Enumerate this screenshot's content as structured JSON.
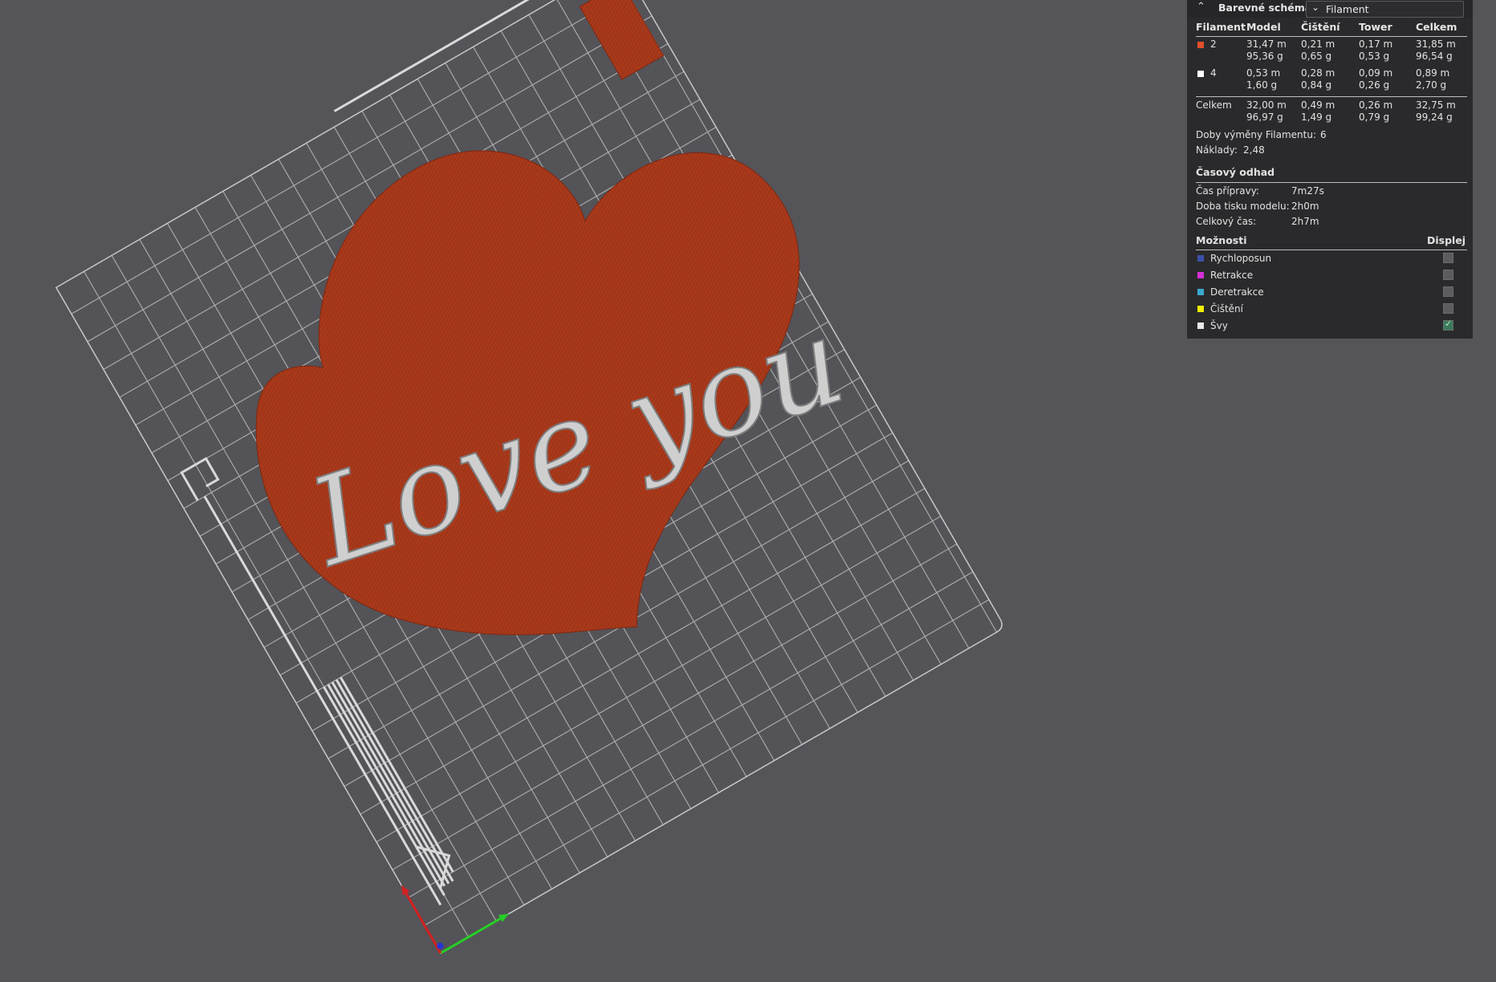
{
  "panel": {
    "title": "Barevné schéma",
    "scheme_value": "Filament",
    "columns": [
      "Filament",
      "Model",
      "Čištění",
      "Tower",
      "Celkem"
    ],
    "filaments": [
      {
        "id": "2",
        "color": "#e0502a",
        "model": [
          "31,47 m",
          "95,36 g"
        ],
        "purge": [
          "0,21 m",
          "0,65 g"
        ],
        "tower": [
          "0,17 m",
          "0,53 g"
        ],
        "total": [
          "31,85 m",
          "96,54 g"
        ]
      },
      {
        "id": "4",
        "color": "#ffffff",
        "model": [
          "0,53 m",
          "1,60 g"
        ],
        "purge": [
          "0,28 m",
          "0,84 g"
        ],
        "tower": [
          "0,09 m",
          "0,26 g"
        ],
        "total": [
          "0,89 m",
          "2,70 g"
        ]
      }
    ],
    "sum": {
      "label": "Celkem",
      "model": [
        "32,00 m",
        "96,97 g"
      ],
      "purge": [
        "0,49 m",
        "1,49 g"
      ],
      "tower": [
        "0,26 m",
        "0,79 g"
      ],
      "total": [
        "32,75 m",
        "99,24 g"
      ]
    },
    "changes_label": "Doby výměny Filamentu:",
    "changes_value": "6",
    "cost_label": "Náklady:",
    "cost_value": "2,48",
    "time_title": "Časový odhad",
    "prep_label": "Čas přípravy:",
    "prep_value": "7m27s",
    "model_time_label": "Doba tisku modelu:",
    "model_time_value": "2h0m",
    "total_time_label": "Celkový čas:",
    "total_time_value": "2h7m",
    "options_title": "Možnosti",
    "display_title": "Displej",
    "options": [
      {
        "label": "Rychloposun",
        "color": "#3b4fa8",
        "checked": false
      },
      {
        "label": "Retrakce",
        "color": "#d52fd6",
        "checked": false
      },
      {
        "label": "Deretrakce",
        "color": "#3aa8d0",
        "checked": false
      },
      {
        "label": "Čištění",
        "color": "#f0f000",
        "checked": false
      },
      {
        "label": "Švy",
        "color": "#e8e8e8",
        "checked": true
      }
    ]
  },
  "viewport": {
    "model_text": "Love you",
    "model_color": "#a63a1c",
    "background": "#555459"
  }
}
